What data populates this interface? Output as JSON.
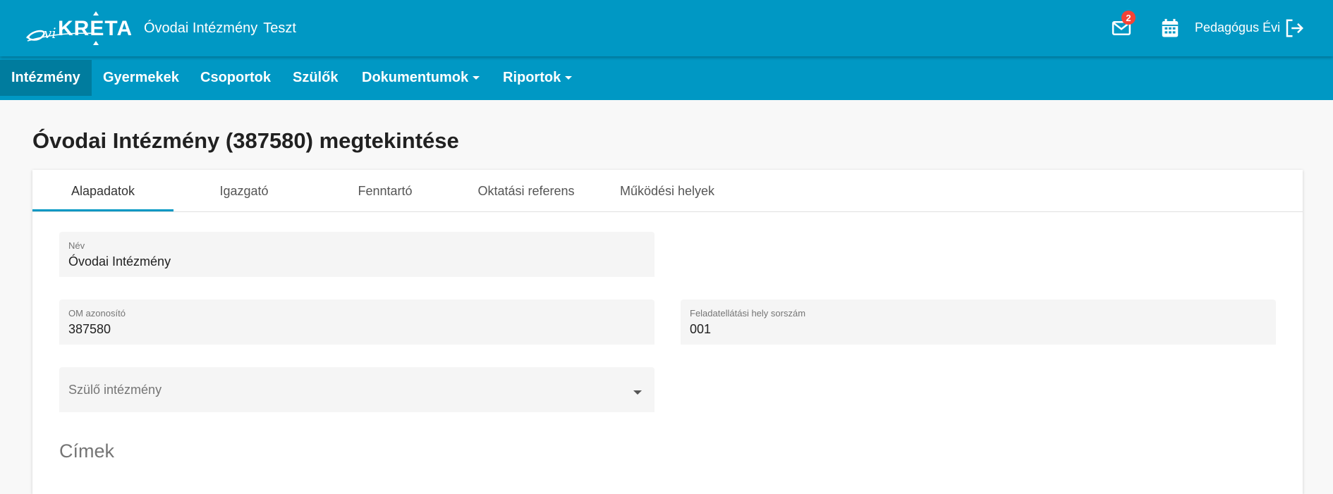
{
  "header": {
    "logo_text": "oviKRÉTA",
    "school_name": "Óvodai Intézmény",
    "school_suffix": "Teszt",
    "mail_badge": "2",
    "user_name": "Pedagógus Évi",
    "icons": [
      "mail-icon",
      "calendar-icon",
      "logout-icon"
    ]
  },
  "nav": {
    "items": [
      {
        "label": "Intézmény",
        "active": true,
        "dropdown": false
      },
      {
        "label": "Gyermekek",
        "active": false,
        "dropdown": false
      },
      {
        "label": "Csoportok",
        "active": false,
        "dropdown": false
      },
      {
        "label": "Szülők",
        "active": false,
        "dropdown": false
      },
      {
        "label": "Dokumentumok",
        "active": false,
        "dropdown": true
      },
      {
        "label": "Riportok",
        "active": false,
        "dropdown": true
      }
    ]
  },
  "page": {
    "title": "Óvodai Intézmény (387580) megtekintése"
  },
  "tabs": [
    {
      "label": "Alapadatok",
      "active": true
    },
    {
      "label": "Igazgató",
      "active": false
    },
    {
      "label": "Fenntartó",
      "active": false
    },
    {
      "label": "Oktatási referens",
      "active": false
    },
    {
      "label": "Működési helyek",
      "active": false
    }
  ],
  "form": {
    "nev": {
      "label": "Név",
      "value": "Óvodai Intézmény"
    },
    "om": {
      "label": "OM azonosító",
      "value": "387580"
    },
    "feladatellatasi": {
      "label": "Feladatellátási hely sorszám",
      "value": "001"
    },
    "szulo": {
      "placeholder": "Szülő intézmény",
      "value": ""
    }
  },
  "sections": {
    "cimek": "Címek"
  },
  "colors": {
    "primary": "#0098c4",
    "nav_active": "#007c9e",
    "badge": "#f44336",
    "page_bg": "#f8f8f8",
    "field_bg": "#f5f5f5"
  }
}
